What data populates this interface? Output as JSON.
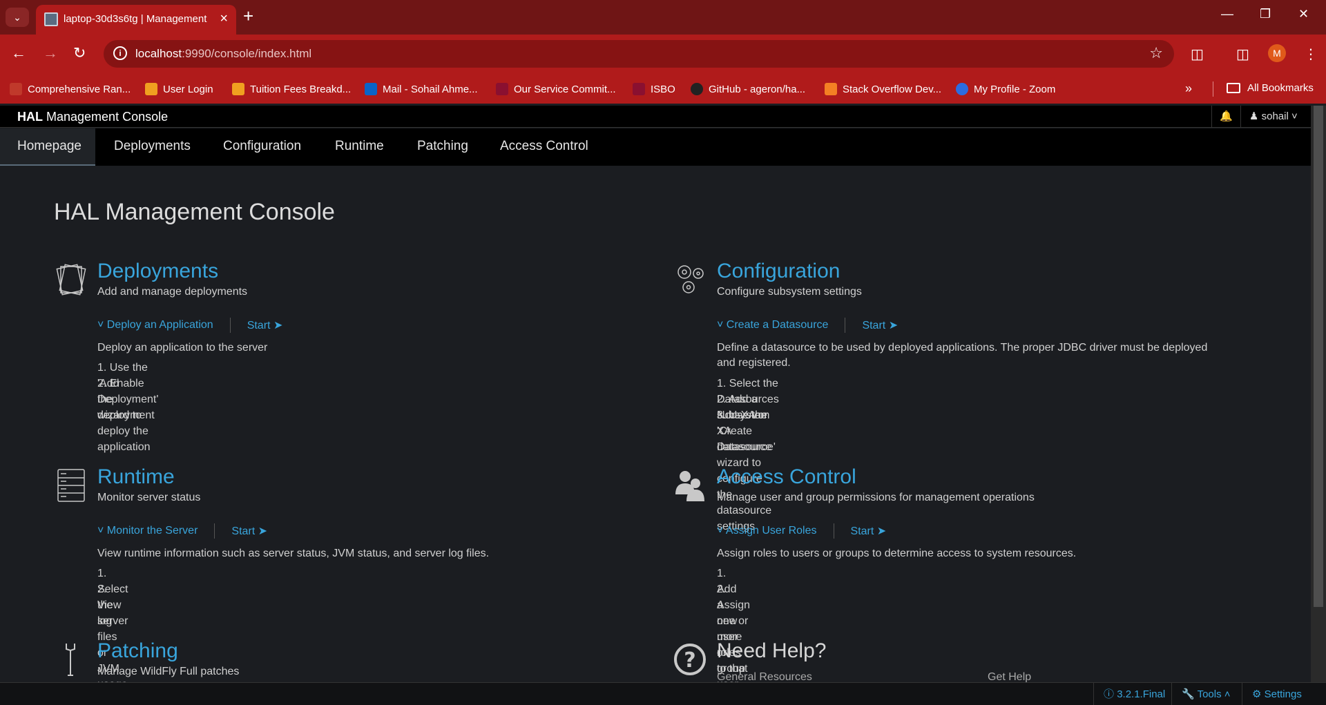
{
  "browser": {
    "tab_title": "laptop-30d3s6tg | Management",
    "url_host": "localhost",
    "url_rest": ":9990/console/index.html",
    "profile_initial": "M",
    "bookmarks": [
      {
        "label": "Comprehensive Ran...",
        "color": "#c0392b"
      },
      {
        "label": "User Login",
        "color": "#f0a020"
      },
      {
        "label": "Tuition Fees Breakd...",
        "color": "#f0a020"
      },
      {
        "label": "Mail - Sohail Ahme...",
        "color": "#0a64c8"
      },
      {
        "label": "Our Service Commit...",
        "color": "#8a1030"
      },
      {
        "label": "ISBO",
        "color": "#8a1030"
      },
      {
        "label": "GitHub - ageron/ha...",
        "color": "#222222"
      },
      {
        "label": "Stack Overflow Dev...",
        "color": "#f48024"
      },
      {
        "label": "My Profile - Zoom",
        "color": "#2d6ce0"
      }
    ],
    "all_bookmarks": "All Bookmarks"
  },
  "hal": {
    "brand_bold": "HAL",
    "brand_rest": " Management Console",
    "user": "sohail",
    "nav": [
      "Homepage",
      "Deployments",
      "Configuration",
      "Runtime",
      "Patching",
      "Access Control"
    ],
    "page_title": "HAL Management Console"
  },
  "cards": {
    "deployments": {
      "title": "Deployments",
      "subtitle": "Add and manage deployments",
      "toggle": "Deploy an Application",
      "start": "Start",
      "desc": "Deploy an application to the server",
      "steps": [
        "1. Use the 'Add Deployment' wizard to deploy the application",
        "2. Enable the deployment"
      ]
    },
    "configuration": {
      "title": "Configuration",
      "subtitle": "Configure subsystem settings",
      "toggle": "Create a Datasource",
      "start": "Start",
      "desc": "Define a datasource to be used by deployed applications. The proper JDBC driver must be deployed and registered.",
      "steps": [
        "1. Select the Datasources subsystem",
        "2. Add a Non-XA or XA datasource",
        "3. Use the 'Create Datasource' wizard to configure the datasource settings"
      ]
    },
    "runtime": {
      "title": "Runtime",
      "subtitle": "Monitor server status",
      "toggle": "Monitor the Server",
      "start": "Start",
      "desc": "View runtime information such as server status, JVM status, and server log files.",
      "steps": [
        "1. Select the server",
        "2. View log files or JVM usage"
      ]
    },
    "access": {
      "title": "Access Control",
      "subtitle": "Manage user and group permissions for management operations",
      "toggle": "Assign User Roles",
      "start": "Start",
      "desc": "Assign roles to users or groups to determine access to system resources.",
      "steps": [
        "1. Add a new user or group",
        "2. Assign one or more roles to that user or group"
      ]
    },
    "patching": {
      "title": "Patching",
      "subtitle": "Manage WildFly Full patches"
    },
    "help": {
      "title": "Need Help?",
      "col1": "General Resources",
      "col2": "Get Help"
    }
  },
  "footer": {
    "version": "3.2.1.Final",
    "tools": "Tools",
    "settings": "Settings"
  },
  "colors": {
    "accent": "#39a5dc",
    "chrome_red": "#b01b1b",
    "chrome_dark": "#6f1515"
  }
}
